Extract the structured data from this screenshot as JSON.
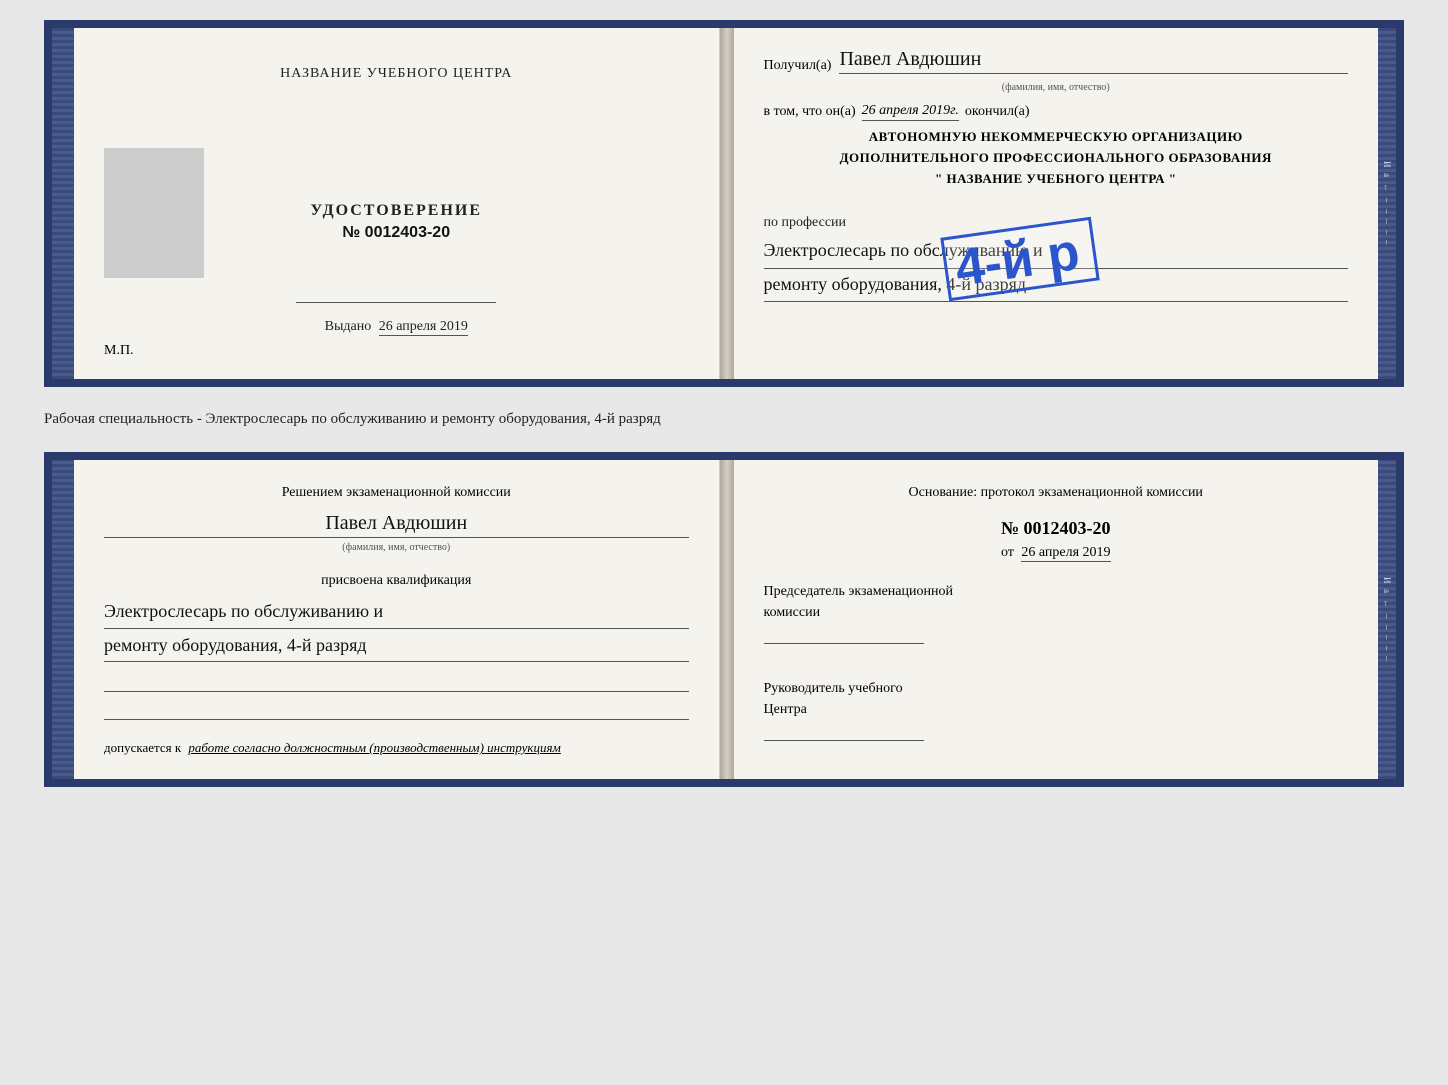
{
  "topDoc": {
    "leftPage": {
      "title": "НАЗВАНИЕ УЧЕБНОГО ЦЕНТРА",
      "certLabel": "УДОСТОВЕРЕНИЕ",
      "certNumber": "№ 0012403-20",
      "issuedLabel": "Выдано",
      "issuedDate": "26 апреля 2019",
      "mpLabel": "М.П."
    },
    "rightPage": {
      "receivedLabel": "Получил(а)",
      "recipientName": "Павел Авдюшин",
      "fioLabel": "(фамилия, имя, отчество)",
      "vtomLabel": "в том, что он(а)",
      "completedDate": "26 апреля 2019г.",
      "completedLabel": "окончил(а)",
      "stampLine1": "4-й р",
      "orgLine1": "АВТОНОМНУЮ НЕКОММЕРЧЕСКУЮ ОРГАНИЗАЦИЮ",
      "orgLine2": "ДОПОЛНИТЕЛЬНОГО ПРОФЕССИОНАЛЬНОГО ОБРАЗОВАНИЯ",
      "orgLine3": "\" НАЗВАНИЕ УЧЕБНОГО ЦЕНТРА \"",
      "professionLabel": "по профессии",
      "professionLine1": "Электрослесарь по обслуживанию и",
      "professionLine2": "ремонту оборудования, 4-й разряд"
    }
  },
  "betweenLabel": "Рабочая специальность - Электрослесарь по обслуживанию и ремонту оборудования, 4-й разряд",
  "bottomDoc": {
    "leftPage": {
      "commissionTitle1": "Решением экзаменационной комиссии",
      "recipientName": "Павел Авдюшин",
      "fioLabel": "(фамилия, имя, отчество)",
      "assignedLabel": "присвоена квалификация",
      "qualLine1": "Электрослесарь по обслуживанию и",
      "qualLine2": "ремонту оборудования, 4-й разряд",
      "допускLabel": "допускается к",
      "допускText": "работе согласно должностным (производственным) инструкциям"
    },
    "rightPage": {
      "osnovanieLabel": "Основание: протокол экзаменационной комиссии",
      "protocolNumber": "№ 0012403-20",
      "dateLabel": "от",
      "protocolDate": "26 апреля 2019",
      "chairLabel1": "Председатель экзаменационной",
      "chairLabel2": "комиссии",
      "headLabel1": "Руководитель учебного",
      "headLabel2": "Центра"
    }
  },
  "sideChars": [
    "И",
    "а",
    "←",
    "–",
    "–",
    "–",
    "–",
    "–"
  ]
}
